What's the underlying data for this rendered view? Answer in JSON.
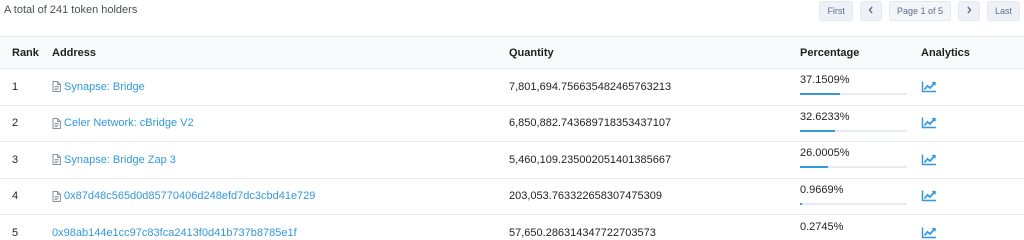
{
  "summary": "A total of 241 token holders",
  "pagination": {
    "first": "First",
    "prev_icon": "chevron-left-icon",
    "page_info": "Page 1 of 5",
    "next_icon": "chevron-right-icon",
    "last": "Last"
  },
  "table": {
    "headers": {
      "rank": "Rank",
      "address": "Address",
      "quantity": "Quantity",
      "percentage": "Percentage",
      "analytics": "Analytics"
    },
    "rows": [
      {
        "rank": "1",
        "address": "Synapse: Bridge",
        "contract": true,
        "quantity": "7,801,694.756635482465763213",
        "percentage": "37.1509%",
        "pct_value": 37.1509
      },
      {
        "rank": "2",
        "address": "Celer Network: cBridge V2",
        "contract": true,
        "quantity": "6,850,882.743689718353437107",
        "percentage": "32.6233%",
        "pct_value": 32.6233
      },
      {
        "rank": "3",
        "address": "Synapse: Bridge Zap 3",
        "contract": true,
        "quantity": "5,460,109.235002051401385667",
        "percentage": "26.0005%",
        "pct_value": 26.0005
      },
      {
        "rank": "4",
        "address": "0x87d48c565d0d85770406d248efd7dc3cbd41e729",
        "contract": true,
        "quantity": "203,053.763322658307475309",
        "percentage": "0.9669%",
        "pct_value": 0.9669
      },
      {
        "rank": "5",
        "address": "0x98ab144e1cc97c83fca2413f0d41b737b8785e1f",
        "contract": false,
        "quantity": "57,650.286314347722703573",
        "percentage": "0.2745%",
        "pct_value": 0.2745
      }
    ]
  },
  "icons": {
    "contract": "file-text-icon",
    "analytics": "area-chart-icon"
  },
  "colors": {
    "link": "#3498db",
    "bar_track": "#e7eaf3",
    "bar_fill": "#3498db",
    "header_bg": "#f8f9fa"
  }
}
